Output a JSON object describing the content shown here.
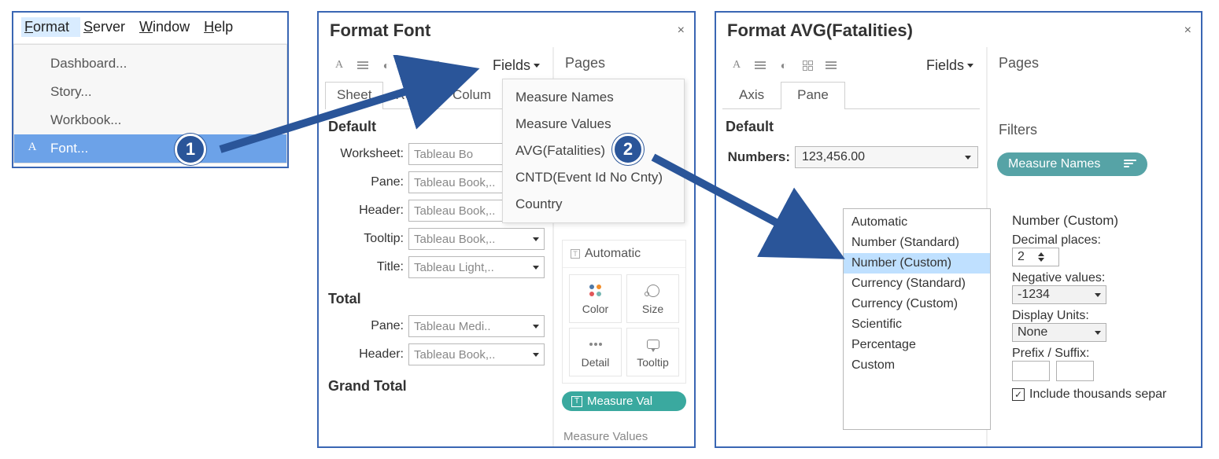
{
  "panel1": {
    "menubar": {
      "format": "Format",
      "server": "Server",
      "window": "Window",
      "help": "Help"
    },
    "menu": {
      "dashboard": "Dashboard...",
      "story": "Story...",
      "workbook": "Workbook...",
      "font": "Font..."
    }
  },
  "panel2": {
    "title": "Format Font",
    "fields_label": "Fields",
    "pages_hdr": "Pages",
    "tabs": {
      "sheet": "Sheet",
      "rows": "Rows",
      "columns": "Colum"
    },
    "sections": {
      "default": "Default",
      "total": "Total",
      "grand_total": "Grand Total"
    },
    "default_rows": {
      "worksheet": {
        "label": "Worksheet:",
        "value": "Tableau Bo"
      },
      "pane": {
        "label": "Pane:",
        "value": "Tableau Book,.."
      },
      "header": {
        "label": "Header:",
        "value": "Tableau Book,.."
      },
      "tooltip": {
        "label": "Tooltip:",
        "value": "Tableau Book,.."
      },
      "title": {
        "label": "Title:",
        "value": "Tableau Light,.."
      }
    },
    "total_rows": {
      "pane": {
        "label": "Pane:",
        "value": "Tableau Medi.."
      },
      "header": {
        "label": "Header:",
        "value": "Tableau Book,.."
      }
    },
    "marks": {
      "header": "Automatic",
      "color": "Color",
      "size": "Size",
      "detail": "Detail",
      "tooltip": "Tooltip"
    },
    "measure_pill": "Measure Val",
    "measure_values_cut": "Measure Values",
    "fields_menu": {
      "mn": "Measure Names",
      "mv": "Measure Values",
      "avg": "AVG(Fatalities)",
      "cntd": "CNTD(Event Id No Cnty)",
      "country": "Country"
    }
  },
  "panel3": {
    "title": "Format AVG(Fatalities)",
    "fields_label": "Fields",
    "pages_hdr": "Pages",
    "filters_hdr": "Filters",
    "filter_pill": "Measure Names",
    "tabs": {
      "axis": "Axis",
      "pane": "Pane"
    },
    "section": "Default",
    "numbers_label": "Numbers:",
    "numbers_value": "123,456.00",
    "num_list": [
      "Automatic",
      "Number (Standard)",
      "Number (Custom)",
      "Currency (Standard)",
      "Currency (Custom)",
      "Scientific",
      "Percentage",
      "Custom"
    ],
    "props": {
      "title": "Number (Custom)",
      "decimal_label": "Decimal places:",
      "decimal_value": "2",
      "neg_label": "Negative values:",
      "neg_value": "-1234",
      "units_label": "Display Units:",
      "units_value": "None",
      "prefix_label": "Prefix / Suffix:",
      "include_thousands": "Include thousands separ"
    }
  },
  "badges": {
    "one": "1",
    "two": "2"
  }
}
